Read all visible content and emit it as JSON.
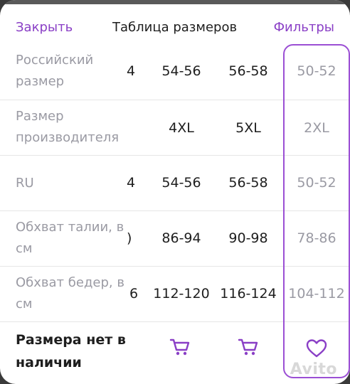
{
  "header": {
    "close_label": "Закрыть",
    "title": "Таблица размеров",
    "filters_label": "Фильтры"
  },
  "rows": [
    {
      "label": "Российский размер",
      "partial": "4",
      "values": [
        "54-56",
        "56-58",
        "50-52"
      ]
    },
    {
      "label": "Размер производителя",
      "partial": "",
      "values": [
        "4XL",
        "5XL",
        "2XL"
      ]
    },
    {
      "label": "RU",
      "partial": "4",
      "values": [
        "54-56",
        "56-58",
        "50-52"
      ]
    },
    {
      "label": "Обхват талии, в см",
      "partial": ")",
      "values": [
        "86-94",
        "90-98",
        "78-86"
      ]
    },
    {
      "label": "Обхват бедер, в см",
      "partial": "6",
      "values": [
        "112-120",
        "116-124",
        "104-112"
      ]
    }
  ],
  "footer": {
    "unavailable_label": "Размера нет в наличии",
    "cart_icon": "cart-icon",
    "heart_icon": "heart-icon"
  },
  "watermark": "Avito",
  "colors": {
    "accent": "#8a3fc6",
    "label": "#9a9aa3",
    "text": "#1e1e1e",
    "highlight": "#9b4fd4"
  }
}
